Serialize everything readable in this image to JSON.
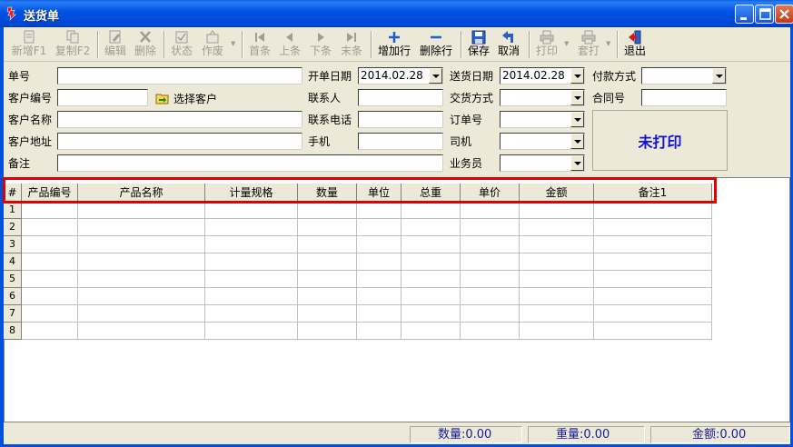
{
  "window": {
    "title": "送货单"
  },
  "toolbar": {
    "buttons": [
      {
        "label": "新增F1",
        "icon": "new-doc-icon"
      },
      {
        "label": "复制F2",
        "icon": "copy-icon"
      },
      {
        "label": "编辑",
        "icon": "edit-icon"
      },
      {
        "label": "删除",
        "icon": "delete-icon"
      },
      {
        "label": "状态",
        "icon": "status-icon"
      },
      {
        "label": "作废",
        "icon": "void-icon"
      },
      {
        "label": "首条",
        "icon": "first-record-icon"
      },
      {
        "label": "上条",
        "icon": "prev-record-icon"
      },
      {
        "label": "下条",
        "icon": "next-record-icon"
      },
      {
        "label": "末条",
        "icon": "last-record-icon"
      },
      {
        "label": "增加行",
        "icon": "plus-icon"
      },
      {
        "label": "删除行",
        "icon": "minus-icon"
      },
      {
        "label": "保存",
        "icon": "save-icon"
      },
      {
        "label": "取消",
        "icon": "cancel-icon"
      },
      {
        "label": "打印",
        "icon": "print-icon"
      },
      {
        "label": "套打",
        "icon": "template-print-icon"
      },
      {
        "label": "退出",
        "icon": "exit-icon"
      }
    ]
  },
  "form": {
    "order_no_label": "单号",
    "order_no_value": "",
    "customer_code_label": "客户编号",
    "customer_code_value": "",
    "select_customer_label": "选择客户",
    "customer_name_label": "客户名称",
    "customer_name_value": "",
    "customer_address_label": "客户地址",
    "customer_address_value": "",
    "remark_label": "备注",
    "remark_value": "",
    "open_date_label": "开单日期",
    "open_date_value": "2014.02.28",
    "contact_label": "联系人",
    "contact_value": "",
    "phone_label": "联系电话",
    "phone_value": "",
    "mobile_label": "手机",
    "mobile_value": "",
    "delivery_date_label": "送货日期",
    "delivery_date_value": "2014.02.28",
    "delivery_method_label": "交货方式",
    "delivery_method_value": "",
    "order_ref_label": "订单号",
    "order_ref_value": "",
    "driver_label": "司机",
    "driver_value": "",
    "salesperson_label": "业务员",
    "salesperson_value": "",
    "payment_label": "付款方式",
    "payment_value": "",
    "contract_label": "合同号",
    "contract_value": "",
    "print_status": "未打印"
  },
  "grid": {
    "columns": [
      "#",
      "产品编号",
      "产品名称",
      "计量规格",
      "数量",
      "单位",
      "总重",
      "单价",
      "金额",
      "备注1"
    ],
    "rows": [
      "1",
      "2",
      "3",
      "4",
      "5",
      "6",
      "7",
      "8"
    ]
  },
  "statusbar": {
    "quantity": "数量:0.00",
    "weight": "重量:0.00",
    "amount": "金额:0.00"
  }
}
